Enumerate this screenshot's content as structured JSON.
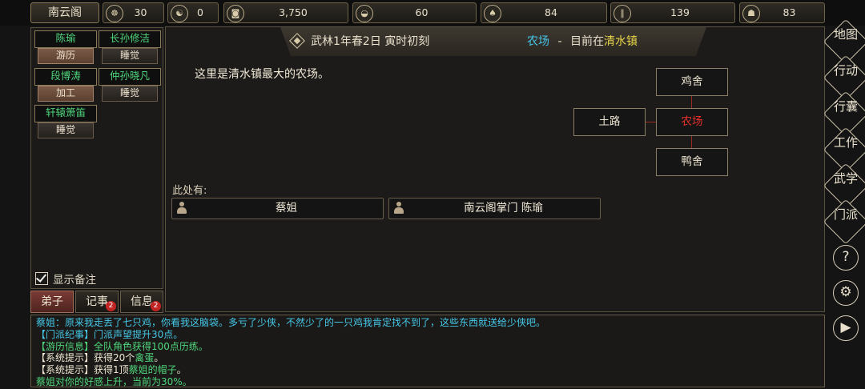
{
  "sect_name": "南云阁",
  "stats": [
    {
      "icon": "seal-icon",
      "glyph": "☸",
      "value": "30"
    },
    {
      "icon": "taiji-icon",
      "glyph": "☯",
      "value": "0"
    },
    {
      "icon": "coin-icon",
      "glyph": "◙",
      "value": "3,750"
    },
    {
      "icon": "food-bowl-icon",
      "glyph": "◒",
      "value": "60"
    },
    {
      "icon": "herb-icon",
      "glyph": "♠",
      "value": "84"
    },
    {
      "icon": "wood-icon",
      "glyph": "∥",
      "value": "139"
    },
    {
      "icon": "ore-icon",
      "glyph": "☗",
      "value": "83"
    }
  ],
  "disciples": [
    {
      "name": "陈瑜",
      "status": "游历"
    },
    {
      "name": "长孙修洁",
      "status": "睡觉"
    },
    {
      "name": "段博涛",
      "status": "加工"
    },
    {
      "name": "仲孙晓凡",
      "status": "睡觉"
    },
    {
      "name": "轩辕箫笛",
      "status": "睡觉"
    }
  ],
  "show_notes_label": "显示备注",
  "bottom_tabs": [
    {
      "label": "弟子",
      "badge": ""
    },
    {
      "label": "记事",
      "badge": "2"
    },
    {
      "label": "信息",
      "badge": "2"
    }
  ],
  "header": {
    "date": "武林1年春2日 寅时初刻",
    "place": "农场",
    "separator": "-",
    "location_prefix": "目前在",
    "town": "清水镇"
  },
  "description": "这里是清水镇最大的农场。",
  "rooms": {
    "north": "鸡舍",
    "current": "农场",
    "west": "土路",
    "south": "鸭舍"
  },
  "here_label": "此处有:",
  "npcs": [
    "蔡姐",
    "南云阁掌门 陈瑜"
  ],
  "right_nav": [
    "地图",
    "行动",
    "行囊",
    "工作",
    "武学",
    "门派"
  ],
  "right_circles": [
    {
      "icon": "help-icon",
      "glyph": "?"
    },
    {
      "icon": "settings-gear-icon",
      "glyph": "⚙"
    },
    {
      "icon": "play-icon",
      "glyph": "▶"
    }
  ],
  "log": [
    {
      "parts": [
        {
          "text": "蔡姐：原来我走丢了七只鸡，你看我这脑袋。多亏了少侠，不然少了的一只鸡我肯定找不到了，这些东西就送给少侠吧。",
          "color": "cyan"
        }
      ]
    },
    {
      "parts": [
        {
          "text": "【门派纪事】门派声望提升30点。",
          "color": "cyan"
        }
      ]
    },
    {
      "parts": [
        {
          "text": "【游历信息】全队角色获得100点历练。",
          "color": "green"
        }
      ]
    },
    {
      "parts": [
        {
          "text": "【系统提示】获得20个",
          "color": "white"
        },
        {
          "text": "禽蛋",
          "color": "green"
        },
        {
          "text": "。",
          "color": "white"
        }
      ]
    },
    {
      "parts": [
        {
          "text": "【系统提示】获得1顶",
          "color": "white"
        },
        {
          "text": "蔡姐的帽子",
          "color": "green"
        },
        {
          "text": "。",
          "color": "white"
        }
      ]
    },
    {
      "parts": [
        {
          "text": "蔡姐对你的好感上升，当前为30%。",
          "color": "green"
        }
      ]
    }
  ]
}
